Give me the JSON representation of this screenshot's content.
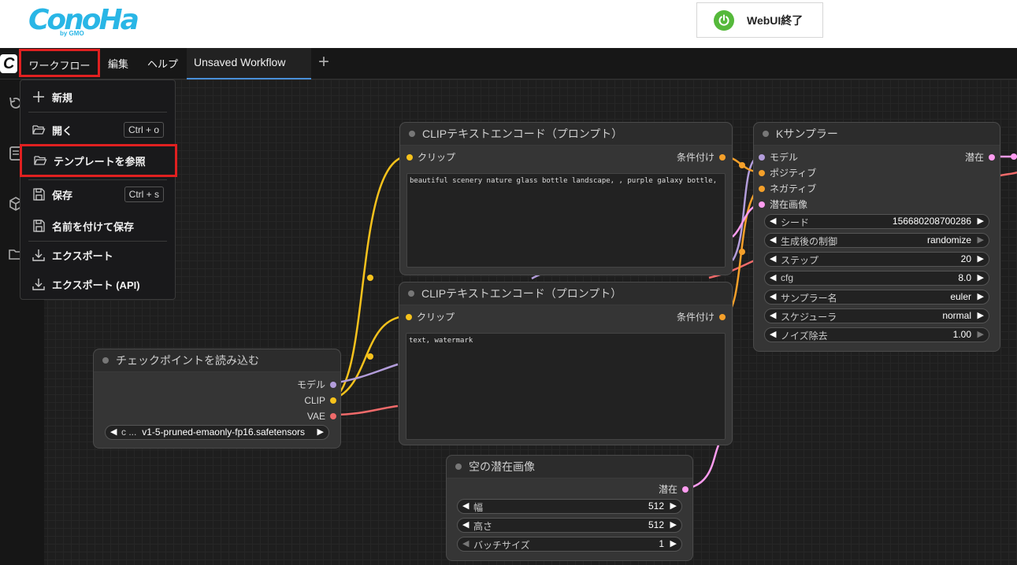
{
  "header": {
    "logo_text": "ConoHa",
    "logo_sub": "by GMO",
    "webui_button": "WebUI終了"
  },
  "menubar": {
    "items": [
      "ワークフロー",
      "編集",
      "ヘルプ"
    ],
    "tab": "Unsaved Workflow",
    "add_tab": "+"
  },
  "workflow_menu": {
    "items": [
      {
        "label": "新規",
        "icon": "plus-icon",
        "shortcut": ""
      },
      {
        "label": "開く",
        "icon": "folder-open-icon",
        "shortcut": "Ctrl + o"
      },
      {
        "label": "テンプレートを参照",
        "icon": "folder-open-icon",
        "shortcut": ""
      },
      {
        "label": "保存",
        "icon": "save-icon",
        "shortcut": "Ctrl + s"
      },
      {
        "label": "名前を付けて保存",
        "icon": "save-icon",
        "shortcut": ""
      },
      {
        "label": "エクスポート",
        "icon": "download-icon",
        "shortcut": ""
      },
      {
        "label": "エクスポート (API)",
        "icon": "download-icon",
        "shortcut": ""
      }
    ]
  },
  "nodes": {
    "clip_pos": {
      "title": "CLIPテキストエンコード（プロンプト）",
      "input": "クリップ",
      "output": "条件付け",
      "text": "beautiful scenery nature glass bottle landscape, , purple galaxy bottle,"
    },
    "clip_neg": {
      "title": "CLIPテキストエンコード（プロンプト）",
      "input": "クリップ",
      "output": "条件付け",
      "text": "text, watermark"
    },
    "ksampler": {
      "title": "Kサンプラー",
      "inputs": [
        "モデル",
        "ポジティブ",
        "ネガティブ",
        "潜在画像"
      ],
      "output": "潜在",
      "widgets": [
        {
          "label": "シード",
          "value": "156680208700286"
        },
        {
          "label": "生成後の制御",
          "value": "randomize"
        },
        {
          "label": "ステップ",
          "value": "20"
        },
        {
          "label": "cfg",
          "value": "8.0"
        },
        {
          "label": "サンプラー名",
          "value": "euler"
        },
        {
          "label": "スケジューラ",
          "value": "normal"
        },
        {
          "label": "ノイズ除去",
          "value": "1.00"
        }
      ]
    },
    "checkpoint": {
      "title": "チェックポイントを読み込む",
      "outputs": [
        "モデル",
        "CLIP",
        "VAE"
      ],
      "widget_label": "c ...",
      "widget_value": "v1-5-pruned-emaonly-fp16.safetensors"
    },
    "latent": {
      "title": "空の潜在画像",
      "output": "潜在",
      "widgets": [
        {
          "label": "幅",
          "value": "512"
        },
        {
          "label": "高さ",
          "value": "512"
        },
        {
          "label": "バッチサイズ",
          "value": "1"
        }
      ]
    }
  },
  "colors": {
    "clip_wire": "#f6c21c",
    "model_wire": "#b39ddb",
    "vae_wire": "#f06a6a",
    "cond_wire": "#f5a02a",
    "latent_wire": "#ff9cf0",
    "highlight": "#e02020",
    "brand": "#29b6e6",
    "power": "#55b93b"
  }
}
